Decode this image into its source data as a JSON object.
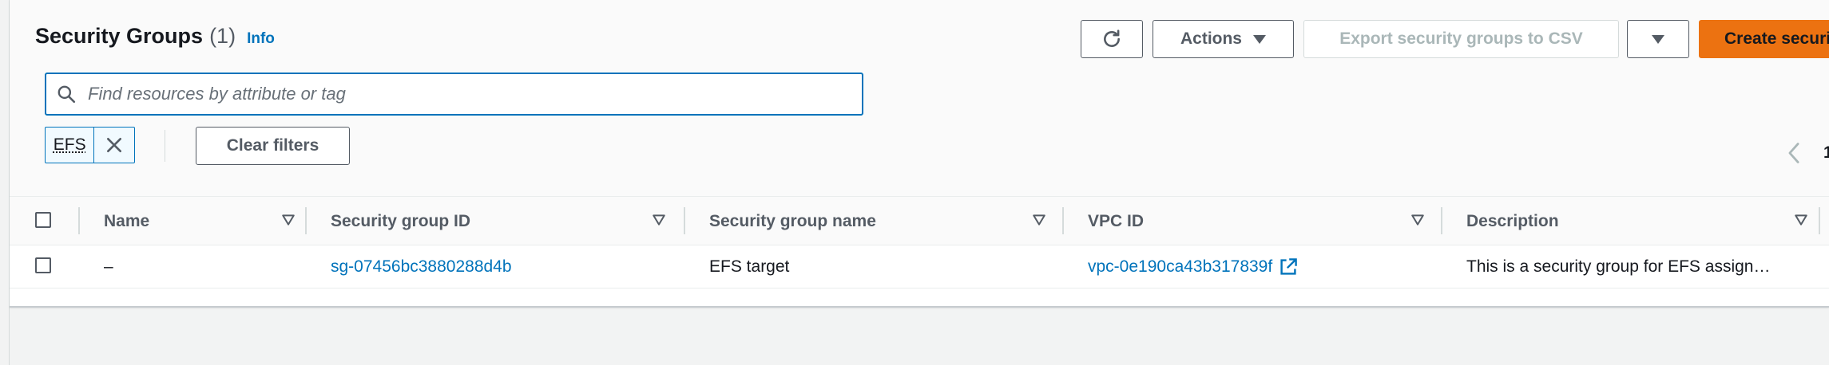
{
  "header": {
    "title": "Security Groups",
    "count": "(1)",
    "info": "Info"
  },
  "toolbar": {
    "actions_label": "Actions",
    "export_label": "Export security groups to CSV",
    "create_label": "Create security group"
  },
  "search": {
    "placeholder": "Find resources by attribute or tag",
    "value": ""
  },
  "filter": {
    "token_label": "EFS",
    "clear_label": "Clear filters"
  },
  "pagination": {
    "current_page": "1"
  },
  "table": {
    "columns": [
      "Name",
      "Security group ID",
      "Security group name",
      "VPC ID",
      "Description"
    ],
    "rows": [
      {
        "name": "–",
        "sg_id": "sg-07456bc3880288d4b",
        "sg_name": "EFS target",
        "vpc_id": "vpc-0e190ca43b317839f",
        "description": "This is a security group for EFS assign…"
      }
    ]
  },
  "colors": {
    "accent": "#0073bb",
    "primary_button": "#ec7211",
    "text": "#16191f",
    "muted": "#545b64"
  },
  "icons": [
    "refresh-icon",
    "caret-down-icon",
    "search-icon",
    "close-icon",
    "chevron-left-icon",
    "sort-icon",
    "external-link-icon"
  ]
}
